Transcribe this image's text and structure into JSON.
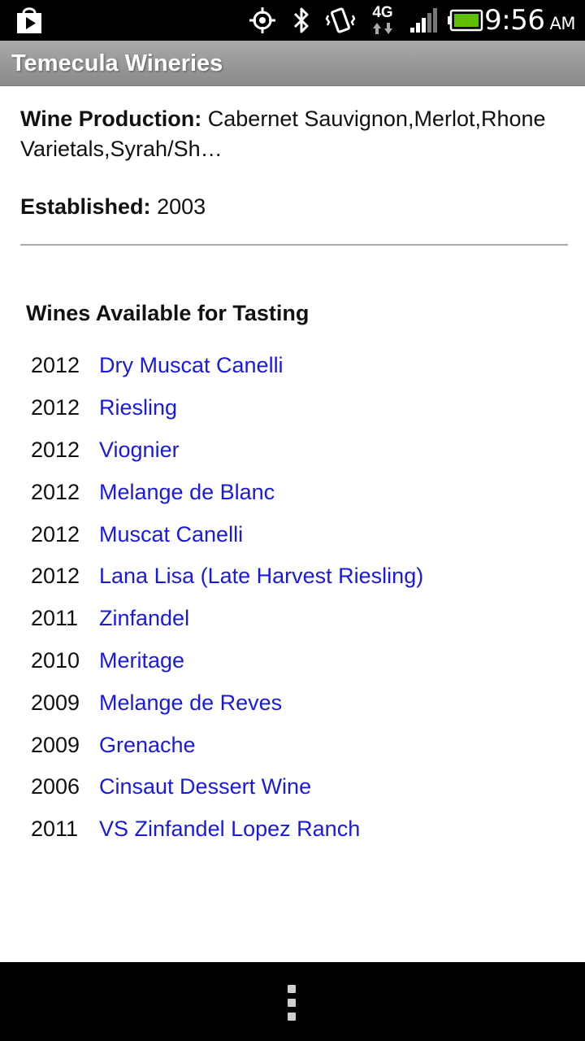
{
  "status_bar": {
    "time": "9:56",
    "ampm": "AM",
    "network": "4G",
    "icons": [
      "play-store-icon",
      "gps-icon",
      "bluetooth-icon",
      "vibrate-icon",
      "network-4g-icon",
      "signal-icon",
      "battery-icon"
    ]
  },
  "title_bar": {
    "title": "Temecula Wineries"
  },
  "winery": {
    "production_label": "Wine Production:",
    "production_value": "Cabernet Sauvignon,Merlot,Rhone Varietals,Syrah/Sh…",
    "established_label": "Established:",
    "established_value": "2003"
  },
  "tasting": {
    "heading": "Wines Available for Tasting",
    "wines": [
      {
        "year": "2012",
        "name": "Dry Muscat Canelli"
      },
      {
        "year": "2012",
        "name": "Riesling"
      },
      {
        "year": "2012",
        "name": "Viognier"
      },
      {
        "year": "2012",
        "name": "Melange de Blanc"
      },
      {
        "year": "2012",
        "name": "Muscat Canelli"
      },
      {
        "year": "2012",
        "name": "Lana Lisa (Late Harvest Riesling)"
      },
      {
        "year": "2011",
        "name": "Zinfandel"
      },
      {
        "year": "2010",
        "name": "Meritage"
      },
      {
        "year": "2009",
        "name": "Melange de Reves"
      },
      {
        "year": "2009",
        "name": "Grenache"
      },
      {
        "year": "2006",
        "name": "Cinsaut Dessert Wine"
      },
      {
        "year": "2011",
        "name": "VS Zinfandel Lopez Ranch"
      }
    ]
  },
  "colors": {
    "link": "#1a1adf",
    "title_bar": "#9a9a9a",
    "battery": "#5ec000"
  }
}
